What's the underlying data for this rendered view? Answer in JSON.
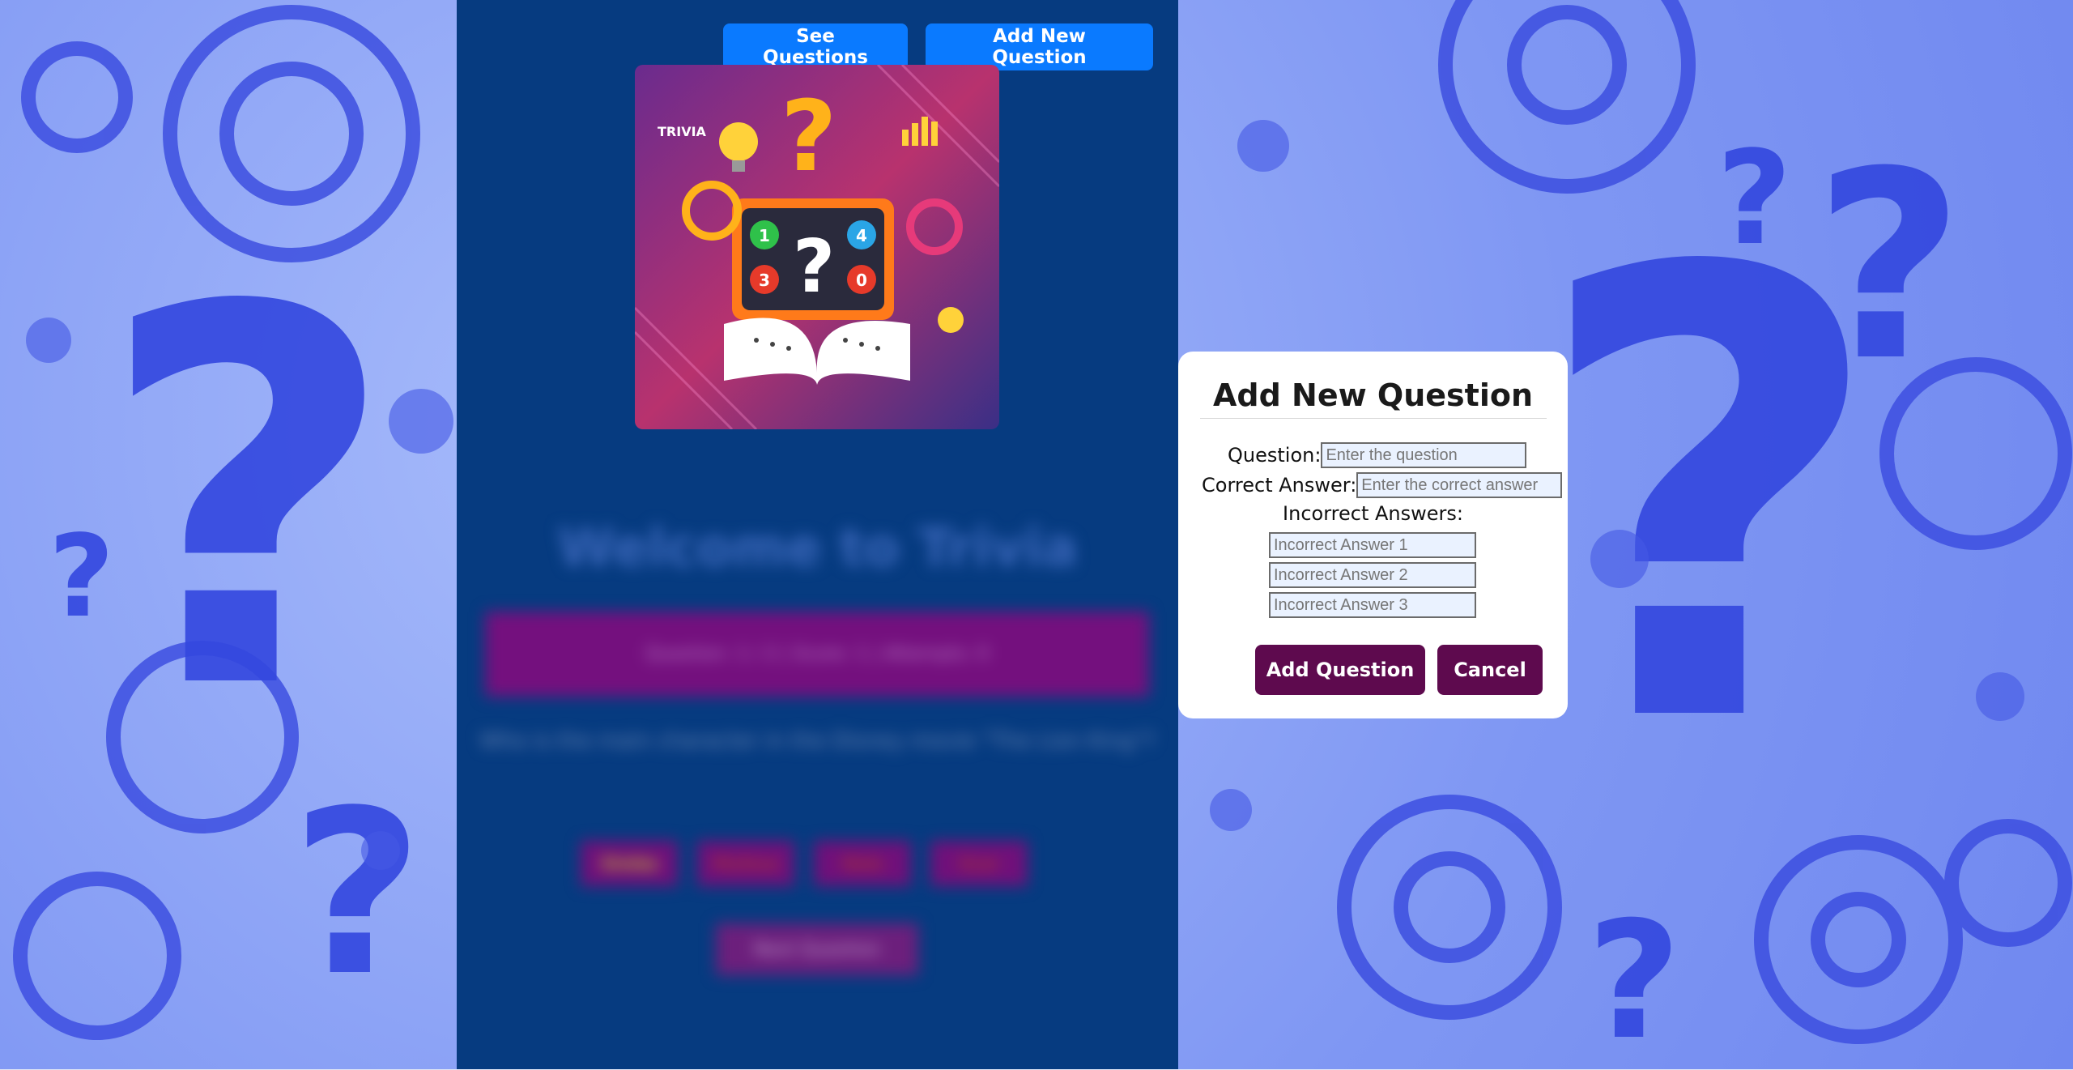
{
  "nav": {
    "see_questions": "See Questions",
    "add_new_question": "Add New Question"
  },
  "hero": {
    "badge_text": "TRIVIA",
    "tiles": [
      "1",
      "4",
      "3",
      "0"
    ],
    "question_mark": "?"
  },
  "background_content": {
    "title": "Welcome to Trivia",
    "score_text": "Question: 1 / 2 | Score: 1 | Attempts: 0",
    "question": "Who is the main character in the Disney movie \"The Lion King\"?",
    "answers": [
      "Simba",
      "Mufasa",
      "Nala",
      "Scar"
    ],
    "next_label": "Next Question"
  },
  "modal": {
    "title": "Add New Question",
    "question_label": "Question:",
    "question_placeholder": "Enter the question",
    "correct_label": "Correct Answer:",
    "correct_placeholder": "Enter the correct answer",
    "incorrect_label": "Incorrect Answers:",
    "incorrect_placeholders": [
      "Incorrect Answer 1",
      "Incorrect Answer 2",
      "Incorrect Answer 3"
    ],
    "add_label": "Add Question",
    "cancel_label": "Cancel"
  },
  "colors": {
    "panel": "#063b80",
    "nav_button": "#0a7aff",
    "modal_button": "#5e0a4e",
    "background": "#8fa6f7"
  }
}
